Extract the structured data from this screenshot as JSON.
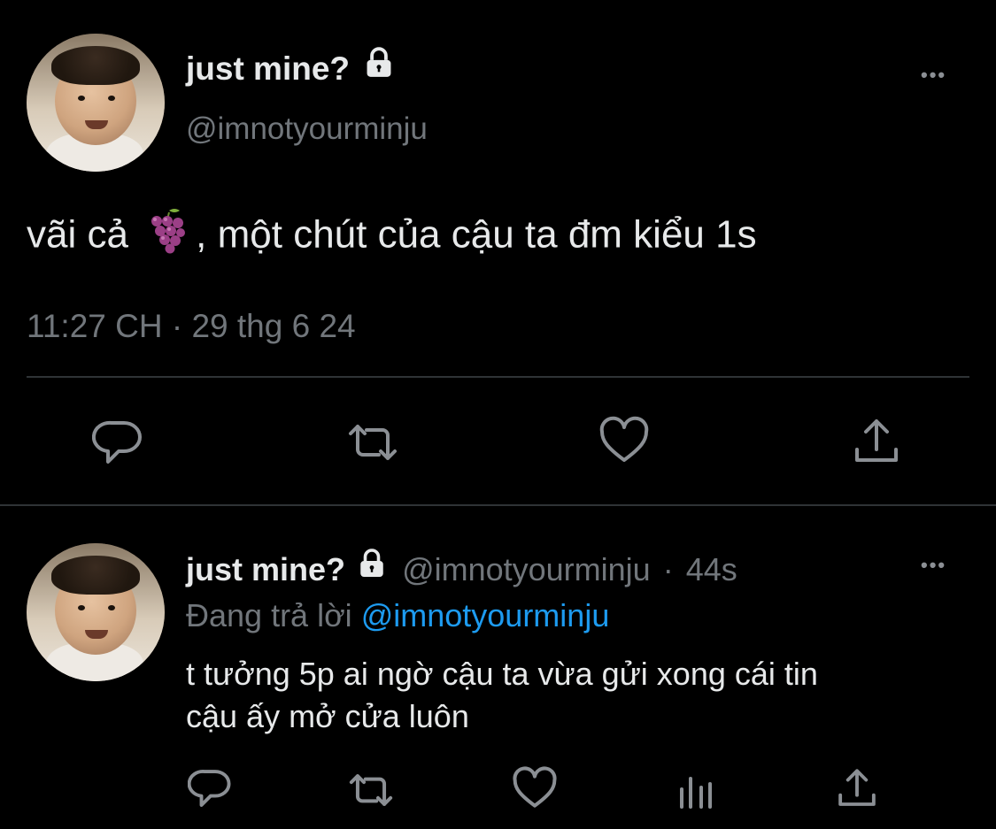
{
  "main_tweet": {
    "display_name": "just mine?",
    "handle": "@imnotyourminju",
    "text_before_emoji": "vãi cả ",
    "emoji": "grapes-emoji",
    "text_after_emoji": ", một chút của cậu ta đm kiểu 1s",
    "timestamp": "11:27 CH · 29 thg 6 24",
    "more_label": "•••",
    "actions": [
      "reply-icon",
      "retweet-icon",
      "like-icon",
      "share-icon"
    ]
  },
  "reply": {
    "display_name": "just mine?",
    "handle": "@imnotyourminju",
    "separator": "·",
    "time": "44s",
    "replying_prefix": "Đang trả lời",
    "replying_to": "@imnotyourminju",
    "text_line1": "t tưởng 5p ai ngờ cậu ta vừa gửi xong cái tin",
    "text_line2": "cậu ấy mở cửa luôn",
    "more_label": "•••",
    "actions": [
      "reply-icon",
      "retweet-icon",
      "like-icon",
      "analytics-icon",
      "share-icon"
    ]
  },
  "colors": {
    "background": "#000000",
    "text": "#e7e9ea",
    "muted": "#71767b",
    "link": "#1d9bf0",
    "divider": "#2f3336",
    "icon": "#8b8f94"
  }
}
